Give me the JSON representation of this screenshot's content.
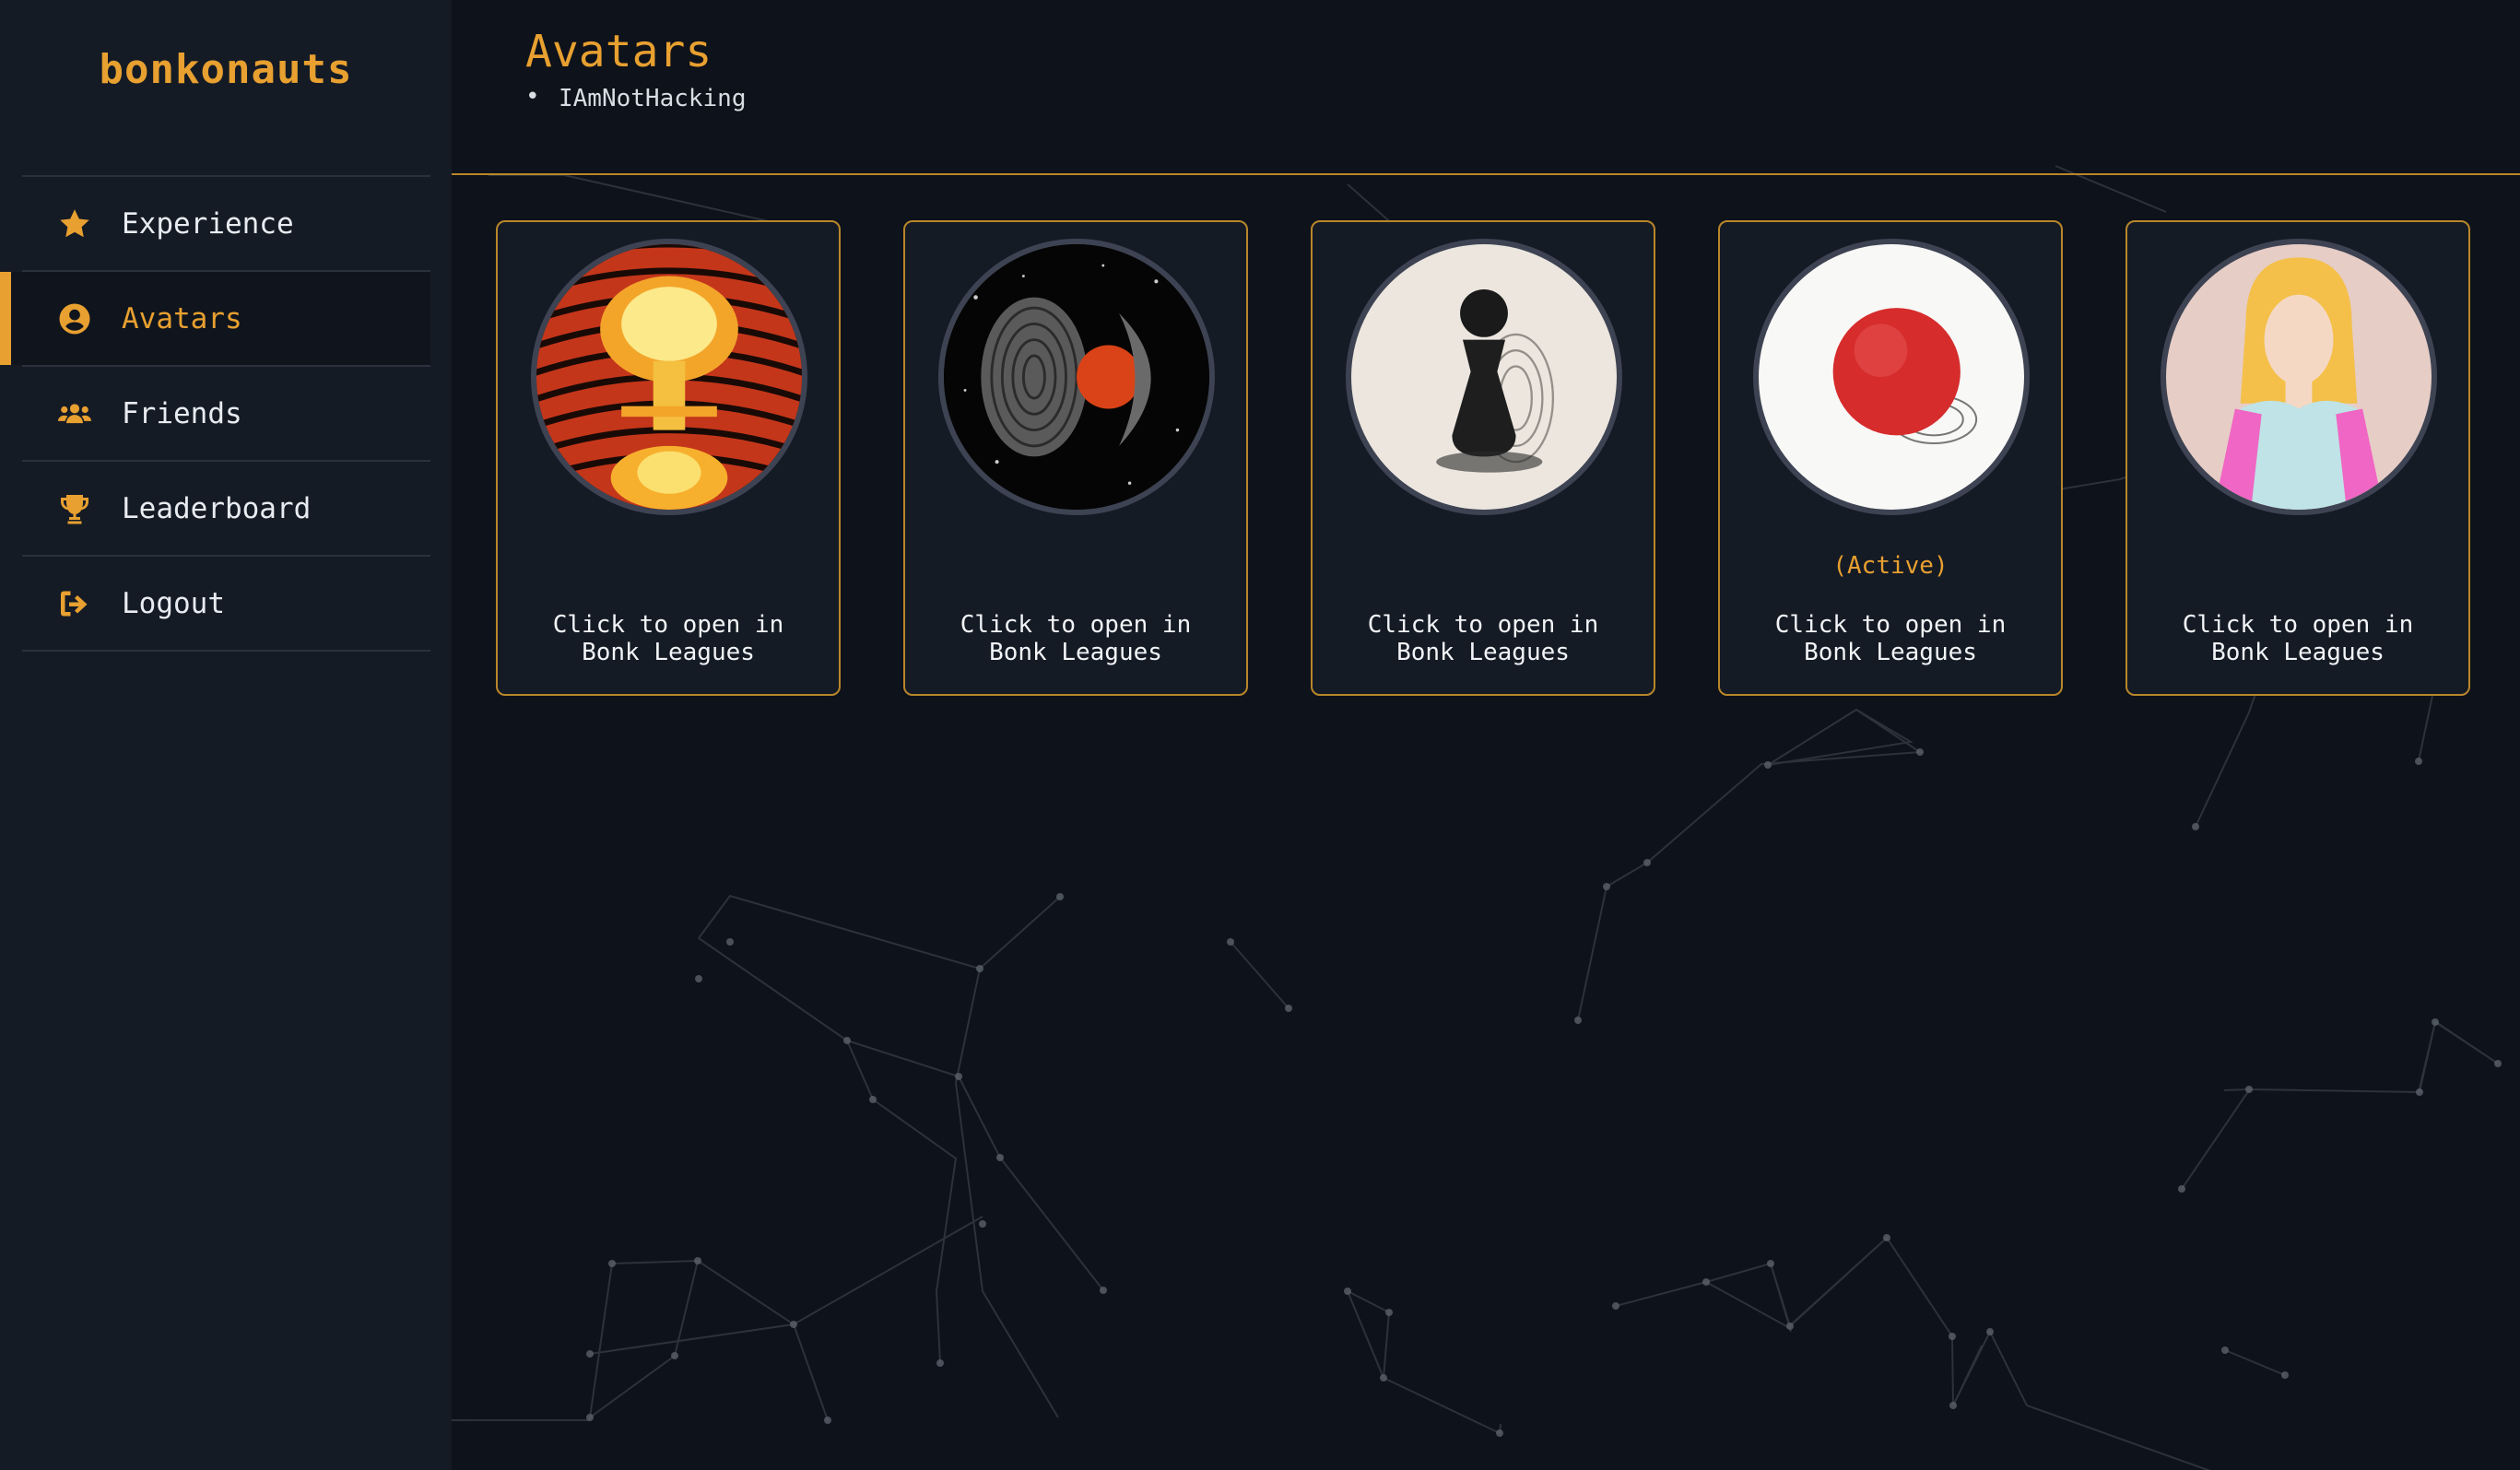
{
  "brand": {
    "name": "bonkonauts"
  },
  "sidebar": {
    "items": [
      {
        "label": "Experience",
        "icon": "star-icon",
        "active": false
      },
      {
        "label": "Avatars",
        "icon": "user-circle-icon",
        "active": true
      },
      {
        "label": "Friends",
        "icon": "users-icon",
        "active": false
      },
      {
        "label": "Leaderboard",
        "icon": "trophy-icon",
        "active": false
      },
      {
        "label": "Logout",
        "icon": "sign-out-icon",
        "active": false
      }
    ]
  },
  "header": {
    "title": "Avatars",
    "users": [
      "IAmNotHacking"
    ]
  },
  "cards": [
    {
      "avatar": "fingerprint-explosion-avatar",
      "status": "",
      "action": "Click to open in\nBonk Leagues"
    },
    {
      "avatar": "fingerprint-planet-split-avatar",
      "status": "",
      "action": "Click to open in\nBonk Leagues"
    },
    {
      "avatar": "fingerprint-pawn-avatar",
      "status": "",
      "action": "Click to open in\nBonk Leagues"
    },
    {
      "avatar": "red-ball-fingerprint-avatar",
      "status": "(Active)",
      "action": "Click to open in\nBonk Leagues"
    },
    {
      "avatar": "anime-girl-avatar",
      "status": "",
      "action": "Click to open in\nBonk Leagues"
    }
  ],
  "colors": {
    "accent": "#e8a030",
    "background": "#0e121a",
    "sidebar": "#151b25",
    "card_border": "#b8862a"
  }
}
